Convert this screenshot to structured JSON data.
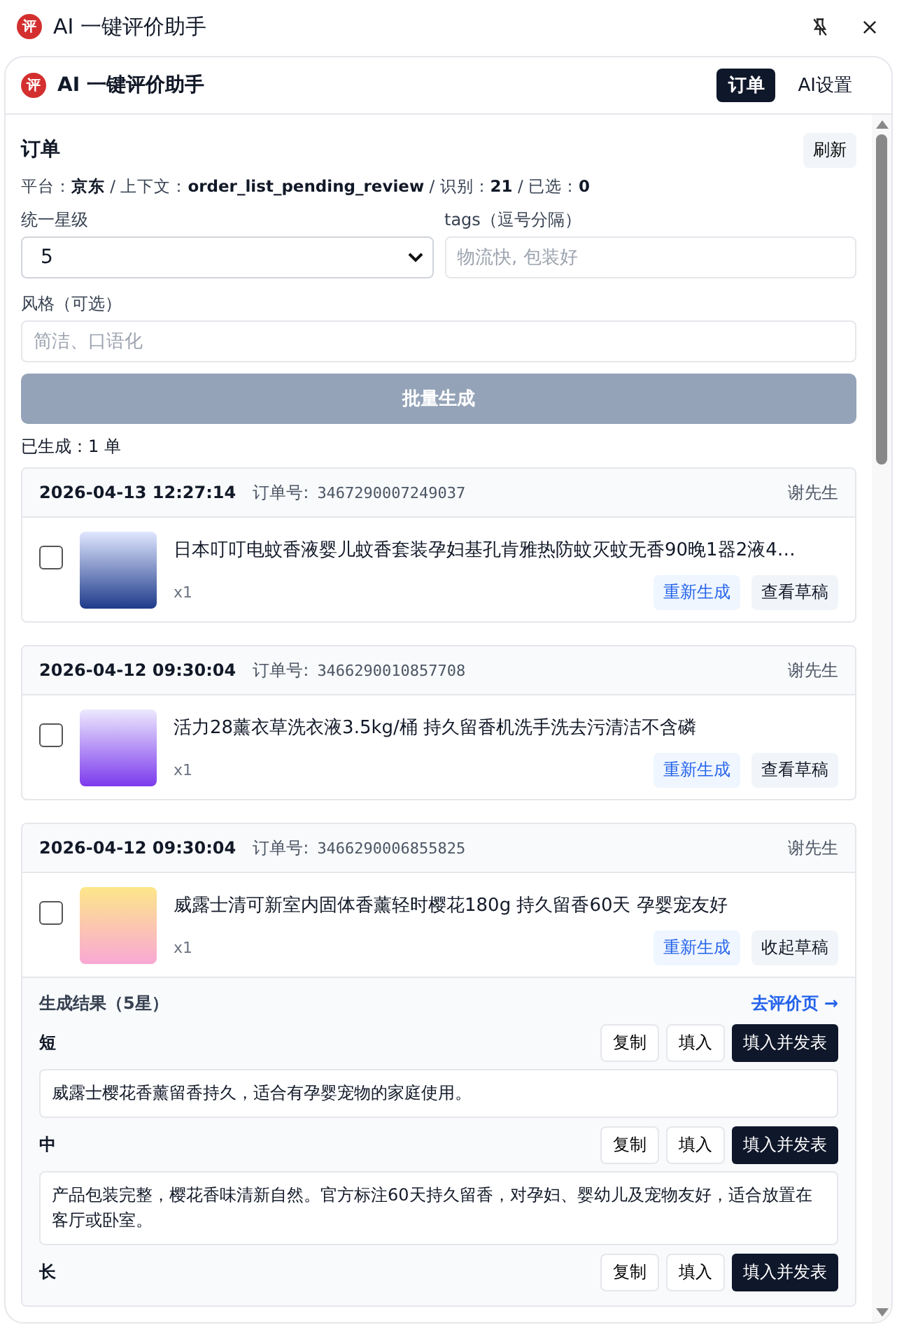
{
  "window": {
    "logo": "评",
    "title": "AI 一键评价助手"
  },
  "panel": {
    "logo": "评",
    "title": "AI 一键评价助手",
    "tabs": [
      {
        "label": "订单",
        "selected": true
      },
      {
        "label": "AI设置",
        "selected": false
      }
    ]
  },
  "section": {
    "title": "订单",
    "refresh_button": "刷新",
    "status": "平台：**京东** / 上下文：**order_list_pending_review** / 识别：**21** / 已选：**0**"
  },
  "form": {
    "star_label": "统一星级",
    "star_value": "5",
    "tags_label": "tags（逗号分隔）",
    "tags_placeholder": "物流快, 包装好",
    "style_label": "风格（可选）",
    "style_placeholder": "简洁、口语化",
    "generate_button": {
      "label": "批量生成",
      "disabled": true
    }
  },
  "generated_count": "已生成：1 单",
  "orders": [
    {
      "date": "2026-04-13 12:27:14",
      "order_label": "订单号:",
      "order_no": "3467290007249037",
      "buyer": "谢先生",
      "checked": false,
      "title": "日本叮叮电蚊香液婴儿蚊香套装孕妇基孔肯雅热防蚊灭蚊无香90晚1器2液4…",
      "qty": "x1",
      "regen_button": "重新生成",
      "draft_button": "查看草稿"
    },
    {
      "date": "2026-04-12 09:30:04",
      "order_label": "订单号:",
      "order_no": "3466290010857708",
      "buyer": "谢先生",
      "checked": false,
      "title": "活力28薰衣草洗衣液3.5kg/桶 持久留香机洗手洗去污清洁不含磷",
      "qty": "x1",
      "regen_button": "重新生成",
      "draft_button": "查看草稿"
    },
    {
      "date": "2026-04-12 09:30:04",
      "order_label": "订单号:",
      "order_no": "3466290006855825",
      "buyer": "谢先生",
      "checked": false,
      "title": "威露士清可新室内固体香薰轻时樱花180g 持久留香60天 孕婴宠友好",
      "qty": "x1",
      "regen_button": "重新生成",
      "draft_button": "收起草稿",
      "expanded": true,
      "results": {
        "title": "生成结果（5星）",
        "link": "去评价页 →",
        "variants": [
          {
            "label": "短",
            "copy": "复制",
            "fill": "填入",
            "publish": "填入并发表",
            "text": "威露士樱花香薰留香持久，适合有孕婴宠物的家庭使用。"
          },
          {
            "label": "中",
            "copy": "复制",
            "fill": "填入",
            "publish": "填入并发表",
            "text": "产品包装完整，樱花香味清新自然。官方标注60天持久留香，对孕妇、婴幼儿及宠物友好，适合放置在客厅或卧室。"
          },
          {
            "label": "长",
            "copy": "复制",
            "fill": "填入",
            "publish": "填入并发表"
          }
        ]
      }
    }
  ]
}
